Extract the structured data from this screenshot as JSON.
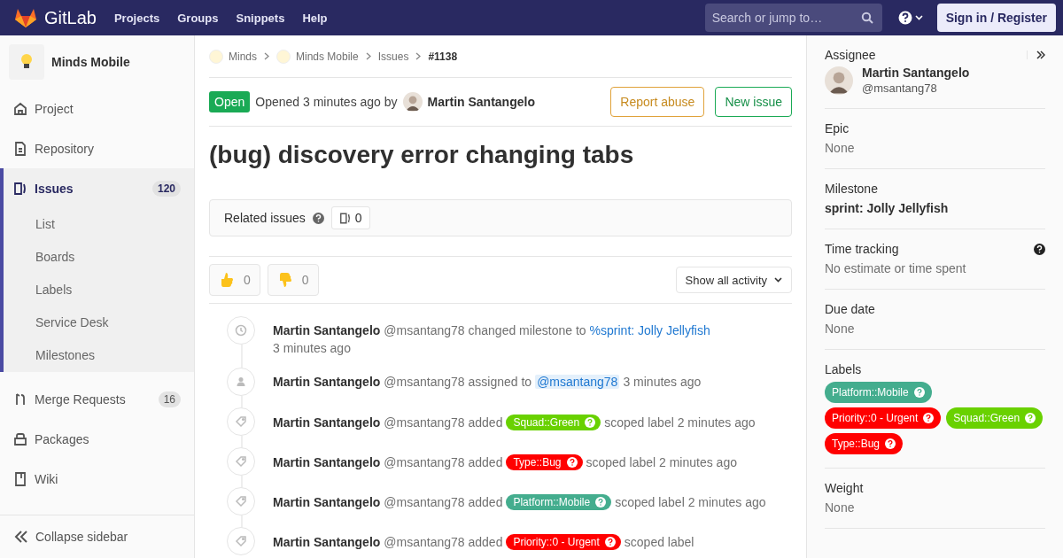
{
  "topbar": {
    "brand": "GitLab",
    "nav": [
      "Projects",
      "Groups",
      "Snippets",
      "Help"
    ],
    "search": {
      "placeholder": "Search or jump to…"
    },
    "sign_in": "Sign in / Register"
  },
  "sidebar": {
    "project": "Minds Mobile",
    "items": [
      {
        "label": "Project",
        "kind": "home",
        "selected": false
      },
      {
        "label": "Repository",
        "kind": "doc",
        "selected": false
      },
      {
        "label": "Issues",
        "kind": "issues",
        "count": "120",
        "selected": true,
        "children": [
          {
            "label": "List"
          },
          {
            "label": "Boards"
          },
          {
            "label": "Labels"
          },
          {
            "label": "Service Desk"
          },
          {
            "label": "Milestones"
          }
        ]
      },
      {
        "label": "Merge Requests",
        "kind": "merge",
        "count": "16",
        "selected": false
      },
      {
        "label": "Packages",
        "kind": "box",
        "selected": false
      },
      {
        "label": "Wiki",
        "kind": "book",
        "selected": false
      }
    ],
    "collapse": "Collapse sidebar"
  },
  "breadcrumbs": [
    "Minds",
    "Minds Mobile",
    "Issues",
    "#1138"
  ],
  "issue": {
    "status": "Open",
    "opened": "Opened 3 minutes ago by",
    "author": "Martin Santangelo",
    "report": "Report abuse",
    "new": "New issue",
    "title": "(bug) discovery error changing tabs"
  },
  "related": {
    "label": "Related issues",
    "count": "0"
  },
  "awards": [
    {
      "kind": "up",
      "count": "0"
    },
    {
      "kind": "down",
      "count": "0"
    }
  ],
  "activity_filter": "Show all activity",
  "notes": [
    {
      "kind": "milestone",
      "author": "Martin Santangelo",
      "handle": "@msantang78",
      "action": "changed milestone to",
      "target": "%sprint: Jolly Jellyfish",
      "time": "3 minutes ago"
    },
    {
      "kind": "assign",
      "author": "Martin Santangelo",
      "handle": "@msantang78",
      "action": "assigned to",
      "target": "@msantang78",
      "tail": "3 minutes ago"
    },
    {
      "kind": "label",
      "author": "Martin Santangelo",
      "handle": "@msantang78",
      "action": "added",
      "target": "Squad::Green",
      "color": "#69d100",
      "tail": "scoped label 2 minutes ago"
    },
    {
      "kind": "label",
      "author": "Martin Santangelo",
      "handle": "@msantang78",
      "action": "added",
      "target": "Type::Bug",
      "color": "#ff0000",
      "tail": "scoped label 2 minutes ago"
    },
    {
      "kind": "label",
      "author": "Martin Santangelo",
      "handle": "@msantang78",
      "action": "added",
      "target": "Platform::Mobile",
      "color": "#44ad8e",
      "tail": "scoped label 2 minutes ago"
    },
    {
      "kind": "label",
      "author": "Martin Santangelo",
      "handle": "@msantang78",
      "action": "added",
      "target": "Priority::0 - Urgent",
      "color": "#ff0000",
      "tail": "scoped label"
    }
  ],
  "right": [
    {
      "kind": "user",
      "title": "Assignee",
      "name": "Martin Santangelo",
      "handle": "@msantang78"
    },
    {
      "kind": "text",
      "title": "Epic",
      "value": "None"
    },
    {
      "kind": "bold",
      "title": "Milestone",
      "value": "sprint: Jolly Jellyfish"
    },
    {
      "kind": "text",
      "title": "Time tracking",
      "value": "No estimate or time spent",
      "help": true
    },
    {
      "kind": "text",
      "title": "Due date",
      "value": "None"
    },
    {
      "kind": "labels",
      "title": "Labels",
      "labels": [
        {
          "text": "Platform::Mobile",
          "color": "#44ad8e"
        },
        {
          "text": "Priority::0 - Urgent",
          "color": "#ff0000"
        },
        {
          "text": "Squad::Green",
          "color": "#69d100"
        },
        {
          "text": "Type::Bug",
          "color": "#ff0000"
        }
      ]
    },
    {
      "kind": "text",
      "title": "Weight",
      "value": "None"
    }
  ]
}
